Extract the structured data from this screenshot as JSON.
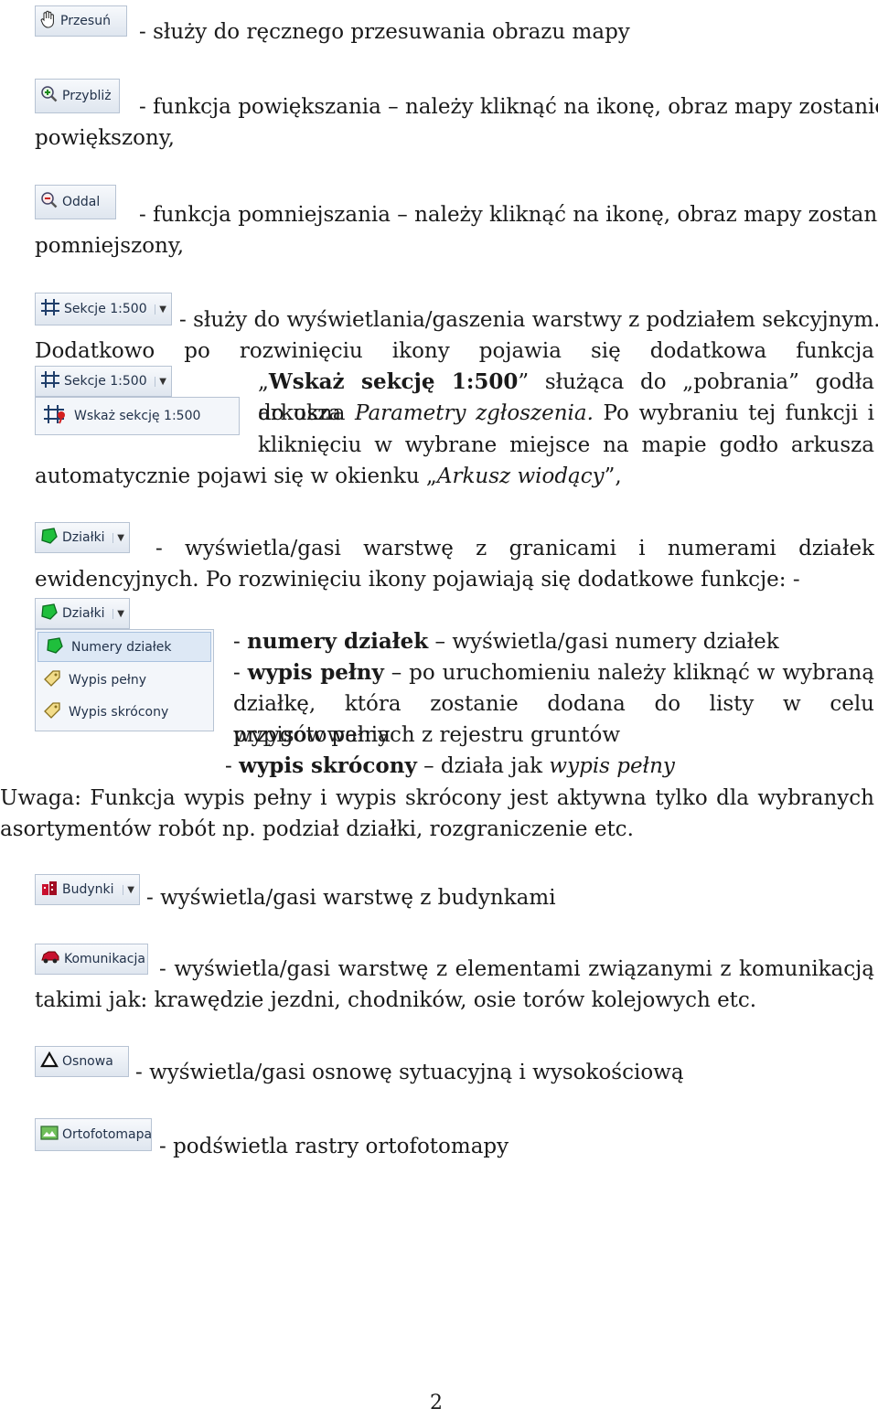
{
  "buttons": {
    "przesun": "Przesuń",
    "przybliz": "Przybliż",
    "oddal": "Oddal",
    "sekcje": "Sekcje 1:500",
    "wskaz_sekcje": "Wskaż sekcję 1:500",
    "dzialki": "Działki",
    "numery_dzialek": "Numery działek",
    "wypis_pelny": "Wypis pełny",
    "wypis_skrocony": "Wypis skrócony",
    "budynki": "Budynki",
    "komunikacja": "Komunikacja",
    "osnowa": "Osnowa",
    "ortofotomapa": "Ortofotomapa"
  },
  "text": {
    "przesun_desc": "- służy do ręcznego przesuwania obrazu mapy",
    "przybliz_line1": "- funkcja powiększania – należy kliknąć na ikonę, obraz mapy zostanie",
    "przybliz_line2": "powiększony,",
    "oddal_line1": "- funkcja pomniejszania – należy kliknąć na ikonę, obraz mapy zostanie",
    "oddal_line2": "pomniejszony,",
    "sekcje_line1": "- służy do wyświetlania/gaszenia warstwy z podziałem sekcyjnym.",
    "sekcje_line2": "Dodatkowo po rozwinięciu ikony pojawia się dodatkowa funkcja",
    "wskaz_q_open": "„",
    "wskaz_bold": "Wskaż sekcję 1:500",
    "wskaz_after": "” służąca do „pobrania” godła arkusza",
    "okna_pre": "do okna ",
    "okna_italic": "Parametry zgłoszenia.",
    "okna_post": " Po wybraniu tej funkcji i",
    "klik_line": "kliknięciu w wybrane miejsce na mapie godło arkusza",
    "auto_pre": "automatycznie pojawi się w okienku „",
    "auto_italic": "Arkusz wiodący",
    "auto_post": "”,",
    "dzialki_line1": "- wyświetla/gasi warstwę z granicami i numerami działek",
    "dzialki_line2": "ewidencyjnych. Po rozwinięciu ikony pojawiają się dodatkowe funkcje: -",
    "numery_pre": "- ",
    "numery_bold": "numery działek",
    "numery_post": " – wyświetla/gasi numery działek",
    "wypis_pre": "- ",
    "wypis_bold": "wypis pełny",
    "wypis_post": " – po uruchomieniu należy kliknąć w wybraną",
    "wypis_line2": "działkę, która zostanie dodana do listy w celu przygotowania",
    "wypis_line3": "wypisów pełnych z rejestru gruntów",
    "skrocony_pre": "- ",
    "skrocony_bold": "wypis skrócony",
    "skrocony_mid": " – działa jak ",
    "skrocony_italic": "wypis pełny",
    "uwaga_line1": "Uwaga: Funkcja wypis pełny i wypis skrócony jest aktywna tylko dla wybranych",
    "uwaga_line2": "asortymentów robót np. podział działki, rozgraniczenie etc.",
    "budynki_desc": "- wyświetla/gasi warstwę z budynkami",
    "komunikacja_line1": "- wyświetla/gasi warstwę z elementami związanymi z komunikacją",
    "komunikacja_line2": "takimi jak:  krawędzie jezdni, chodników, osie torów kolejowych etc.",
    "osnowa_desc": "- wyświetla/gasi osnowę sytuacyjną i wysokościową",
    "orto_desc": "- podświetla rastry ortofotomapy"
  },
  "page_number": "2"
}
